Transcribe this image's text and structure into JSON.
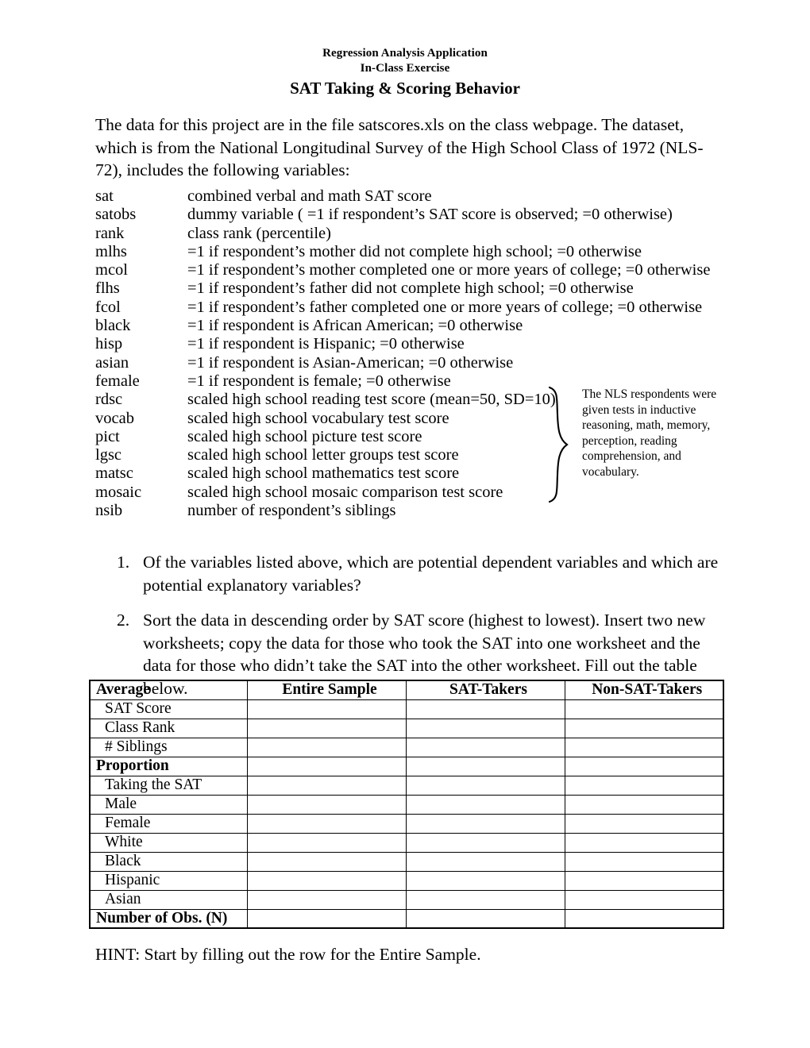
{
  "header": {
    "line1": "Regression Analysis Application",
    "line2": "In-Class Exercise",
    "title": "SAT Taking & Scoring Behavior"
  },
  "intro": {
    "paragraph": "The data for this project are in the file satscores.xls on the class webpage.  The dataset, which is from the National Longitudinal Survey of the High School Class of 1972 (NLS-72), includes the following variables:"
  },
  "variables": [
    {
      "name": "sat",
      "description": "combined verbal and math SAT score"
    },
    {
      "name": "satobs",
      "description": "dummy variable ( =1 if respondent’s SAT score is observed; =0 otherwise)"
    },
    {
      "name": "rank",
      "description": "class rank (percentile)"
    },
    {
      "name": "mlhs",
      "description": "=1 if respondent’s mother did not complete high school; =0 otherwise"
    },
    {
      "name": "mcol",
      "description": "=1 if respondent’s mother completed one or more years of college; =0 otherwise"
    },
    {
      "name": "flhs",
      "description": "=1 if respondent’s father did not complete high school; =0 otherwise"
    },
    {
      "name": "fcol",
      "description": "=1 if respondent’s father completed one or more years of college; =0 otherwise"
    },
    {
      "name": "black",
      "description": "=1 if respondent is African American; =0 otherwise"
    },
    {
      "name": "hisp",
      "description": "=1 if respondent is Hispanic; =0 otherwise"
    },
    {
      "name": "asian",
      "description": "=1 if respondent is Asian-American; =0 otherwise"
    },
    {
      "name": "female",
      "description": "=1 if respondent is female; =0 otherwise"
    },
    {
      "name": "rdsc",
      "description": "scaled high school reading test score (mean=50, SD=10)"
    },
    {
      "name": "vocab",
      "description": "scaled high school vocabulary test score"
    },
    {
      "name": "pict",
      "description": "scaled high school picture test score"
    },
    {
      "name": "lgsc",
      "description": "scaled high school letter groups test score"
    },
    {
      "name": "matsc",
      "description": "scaled high school mathematics test score"
    },
    {
      "name": "mosaic",
      "description": "scaled high school mosaic comparison test score"
    },
    {
      "name": "nsib",
      "description": "number of respondent’s siblings"
    }
  ],
  "sidenote": {
    "text": "The NLS respondents were given tests in inductive reasoning, math, memory, perception, reading comprehension, and vocabulary."
  },
  "questions": [
    {
      "number": "1.",
      "text": "Of the variables listed above, which are potential dependent variables and which are potential explanatory variables?"
    },
    {
      "number": "2.",
      "text": "Sort the data in descending order by SAT score (highest to lowest).  Insert two new worksheets; copy the data for those who took the SAT into one worksheet and the data for those who didn’t take the SAT into the other worksheet.  Fill out the table below."
    }
  ],
  "table": {
    "columns": [
      "Average",
      "Entire Sample",
      "SAT-Takers",
      "Non-SAT-Takers"
    ],
    "rows": [
      {
        "label": "SAT Score",
        "style": "indent",
        "values": [
          "",
          "",
          ""
        ]
      },
      {
        "label": "Class Rank",
        "style": "indent",
        "values": [
          "",
          "",
          ""
        ]
      },
      {
        "label": "# Siblings",
        "style": "indent",
        "values": [
          "",
          "",
          ""
        ]
      },
      {
        "label": "Proportion",
        "style": "bold",
        "values": [
          "",
          "",
          ""
        ]
      },
      {
        "label": "Taking the SAT",
        "style": "indent",
        "values": [
          "",
          "",
          ""
        ]
      },
      {
        "label": "Male",
        "style": "indent",
        "values": [
          "",
          "",
          ""
        ]
      },
      {
        "label": "Female",
        "style": "indent",
        "values": [
          "",
          "",
          ""
        ]
      },
      {
        "label": "White",
        "style": "indent",
        "values": [
          "",
          "",
          ""
        ]
      },
      {
        "label": "Black",
        "style": "indent",
        "values": [
          "",
          "",
          ""
        ]
      },
      {
        "label": "Hispanic",
        "style": "indent",
        "values": [
          "",
          "",
          ""
        ]
      },
      {
        "label": "Asian",
        "style": "indent",
        "values": [
          "",
          "",
          ""
        ]
      },
      {
        "label": "Number of Obs. (N)",
        "style": "bold",
        "values": [
          "",
          "",
          ""
        ]
      }
    ]
  },
  "hint": {
    "text": "HINT:  Start by filling out the row for the Entire Sample."
  }
}
